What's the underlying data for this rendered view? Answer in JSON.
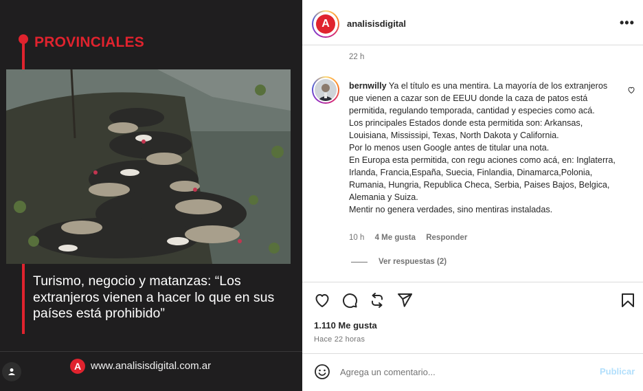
{
  "post_image": {
    "section_label": "PROVINCIALES",
    "headline": "Turismo, negocio y matanzas: “Los extranjeros vienen a hacer lo que en sus países está prohibido”",
    "brand_url": "www.analisisdigital.com.ar",
    "brand_logo_letter": "A"
  },
  "header": {
    "username": "analisisdigital",
    "logo_letter": "A",
    "more_label": "•••"
  },
  "previous_comment": {
    "time": "22 h"
  },
  "comment": {
    "username": "bernwilly",
    "text": "Ya el título es una mentira. La mayoría de los extranjeros que vienen a cazar son de EEUU donde la caza de patos está permitida, regulando temporada, cantidad y especies como acá.\nLos principales Estados donde esta permitida son: Arkansas, Louisiana, Mississipi, Texas, North Dakota y California.\nPor lo menos usen Google antes de titular una nota.\nEn Europa esta permitida, con regu aciones como acá, en: Inglaterra, Irlanda, Francia,España, Suecia, Finlandia, Dinamarca,Polonia, Rumania, Hungria, Republica Checa, Serbia, Paises Bajos, Belgica, Alemania y Suiza.\nMentir no genera verdades, sino mentiras instaladas.",
    "time": "10 h",
    "likes": "4 Me gusta",
    "reply_label": "Responder",
    "view_replies": "Ver respuestas (2)"
  },
  "post_stats": {
    "likes": "1.110 Me gusta",
    "posted": "Hace 22 horas"
  },
  "add_comment": {
    "placeholder": "Agrega un comentario...",
    "publish_label": "Publicar"
  },
  "colors": {
    "brand_red": "#e0232e",
    "dark_bg": "#1f1e1f",
    "publish_disabled": "#b2dffc"
  }
}
